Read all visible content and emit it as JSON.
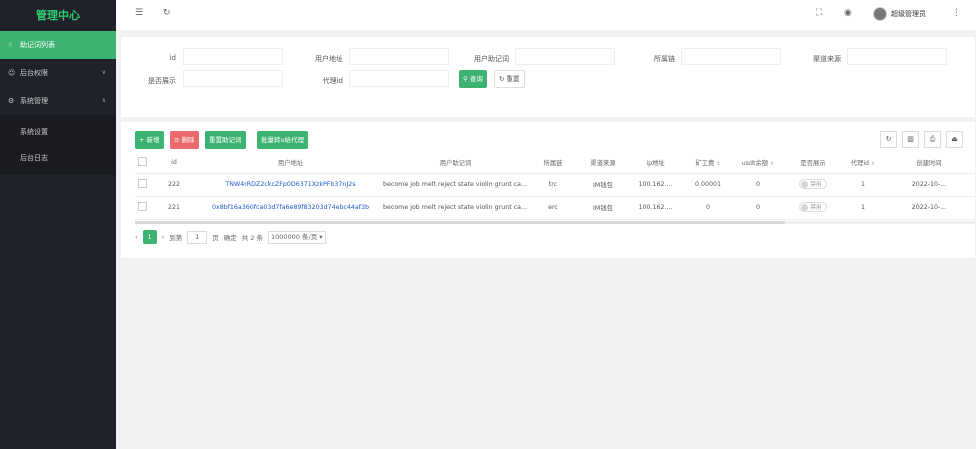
{
  "sidebar": {
    "brand": "管理中心",
    "items": [
      {
        "label": "助记词列表",
        "icon": "hand-icon"
      },
      {
        "label": "后台权限",
        "icon": "user-icon"
      },
      {
        "label": "系统管理",
        "icon": "gear-icon"
      }
    ],
    "sub_items": [
      {
        "label": "系统设置"
      },
      {
        "label": "后台日志"
      }
    ]
  },
  "topbar": {
    "user_name": "超级管理员",
    "icons": [
      "menu-toggle-icon",
      "refresh-icon",
      "fullscreen-icon",
      "theme-icon",
      "more-icon"
    ]
  },
  "search": {
    "labels": {
      "id": "id",
      "address": "用户地址",
      "mnemonic": "用户助记词",
      "chain": "所属链",
      "source": "渠道来源",
      "show": "是否展示",
      "agent": "代理id"
    },
    "query_button": "查询",
    "reset_button": "重置"
  },
  "toolbar": {
    "add_button": "+ 新增",
    "delete_button": "删除",
    "set_agent_button": "重置助记词",
    "batch_button": "批量转u给代理"
  },
  "table": {
    "headers": [
      "id",
      "用户地址",
      "用户助记词",
      "所属链",
      "渠道来源",
      "ip地址",
      "矿工费",
      "usdt余额",
      "是否展示",
      "代理id",
      "创建时间"
    ],
    "rows": [
      {
        "id": "222",
        "address": "TNW4rRDZ2ckcZFp0D6371XzkPFb37nJ2s",
        "mnemonic": "become job melt reject state violin grunt cabin cattle r...",
        "chain": "trc",
        "source": "IM钱包",
        "ip": "100.162....",
        "fee": "0.00001",
        "usdt": "0",
        "show": "禁用",
        "agent": "1",
        "created": "2022-10-..."
      },
      {
        "id": "221",
        "address": "0x8bf16a360fca03d7fa6e89f83203d74ebc44af3b",
        "mnemonic": "become job melt reject state violin grunt cabin cattle r...",
        "chain": "erc",
        "source": "IM钱包",
        "ip": "100.162....",
        "fee": "0",
        "usdt": "0",
        "show": "禁用",
        "agent": "1",
        "created": "2022-10-..."
      }
    ]
  },
  "pager": {
    "prev": "‹",
    "current": "1",
    "next": "›",
    "goto_label": "到第",
    "goto_value": "1",
    "page_unit": "页",
    "confirm": "确定",
    "total": "共 2 条",
    "page_size": "1000000 条/页"
  },
  "colors": {
    "accent": "#3cb371",
    "danger": "#e86a6a",
    "sidebar_bg": "#20222a",
    "link": "#1e5ccc"
  }
}
